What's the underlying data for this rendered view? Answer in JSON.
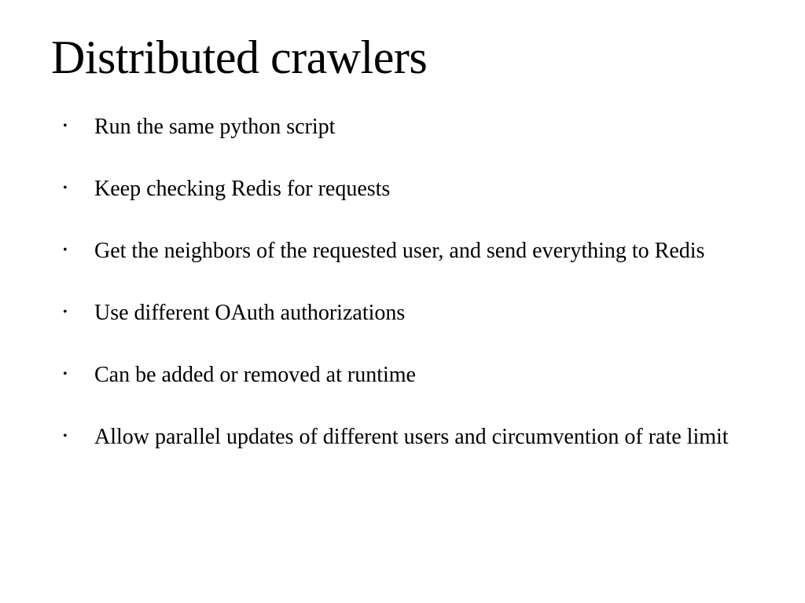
{
  "slide": {
    "title": "Distributed crawlers",
    "bullets": [
      "Run the same python script",
      "Keep checking Redis for requests",
      "Get the neighbors of the requested user, and send everything to Redis",
      "Use different OAuth authorizations",
      "Can be added or removed at runtime",
      "Allow parallel updates of different users and circumvention of rate limit"
    ]
  }
}
